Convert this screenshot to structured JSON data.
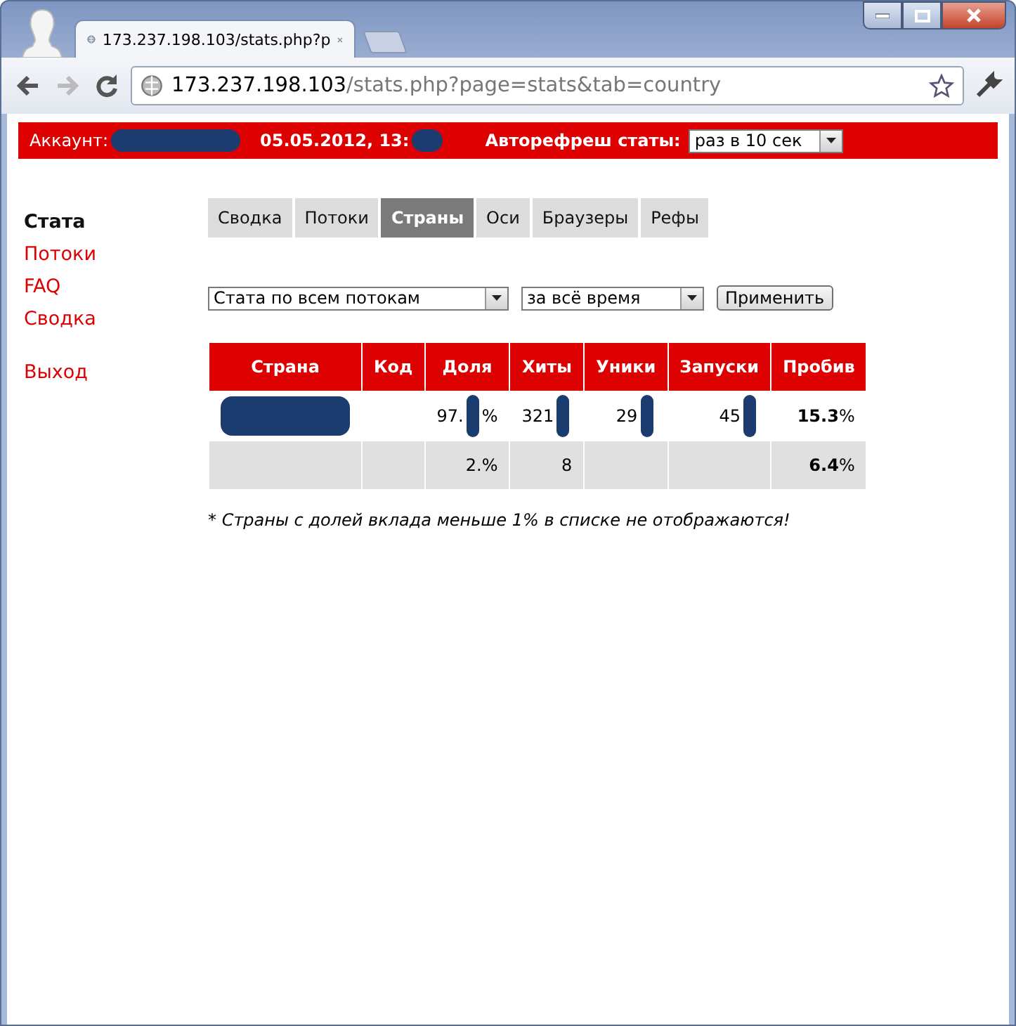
{
  "browser": {
    "tab_title": "173.237.198.103/stats.php?p",
    "address_host": "173.237.198.103",
    "address_path": "/stats.php?page=stats&tab=country"
  },
  "header": {
    "account_label": "Аккаунт:",
    "account_redacted": true,
    "datetime": "05.05.2012, 13:",
    "datetime_redacted": true,
    "autorefresh_label": "Авторефреш статы:",
    "autorefresh_value": "раз в 10 сек"
  },
  "sidebar": {
    "groups": [
      [
        {
          "label": "Стата",
          "selected": true
        },
        {
          "label": "Потоки",
          "selected": false
        },
        {
          "label": "FAQ",
          "selected": false
        },
        {
          "label": "Сводка",
          "selected": false
        }
      ],
      [
        {
          "label": "Выход",
          "selected": false
        }
      ]
    ]
  },
  "tabs": [
    {
      "label": "Сводка",
      "selected": false
    },
    {
      "label": "Потоки",
      "selected": false
    },
    {
      "label": "Страны",
      "selected": true
    },
    {
      "label": "Оси",
      "selected": false
    },
    {
      "label": "Браузеры",
      "selected": false
    },
    {
      "label": "Рефы",
      "selected": false
    }
  ],
  "filters": {
    "stream": "Стата по всем потокам",
    "period": "за всё время",
    "apply": "Применить"
  },
  "table": {
    "columns": [
      "Страна",
      "Код",
      "Доля",
      "Хиты",
      "Уники",
      "Запуски",
      "Пробив"
    ],
    "rows": [
      {
        "cells": [
          {
            "redacted": true
          },
          {
            "redacted": false
          },
          {
            "text": "97.",
            "suffix": "%",
            "redacted": true
          },
          {
            "text": "321",
            "redacted": true
          },
          {
            "text": "29",
            "redacted": true
          },
          {
            "text": "45",
            "redacted": true
          },
          {
            "text": "**15.3**%",
            "redacted": false
          }
        ]
      },
      {
        "cells": [
          {
            "redacted": false
          },
          {
            "redacted": false
          },
          {
            "text": "2.",
            "suffix": "%",
            "redacted": false
          },
          {
            "text": "8",
            "redacted": false
          },
          {
            "redacted": false
          },
          {
            "redacted": false
          },
          {
            "text": "**6.4**%",
            "redacted": false
          }
        ]
      }
    ]
  },
  "note": "* Страны с долей вклада меньше 1% в списке не отображаются!"
}
